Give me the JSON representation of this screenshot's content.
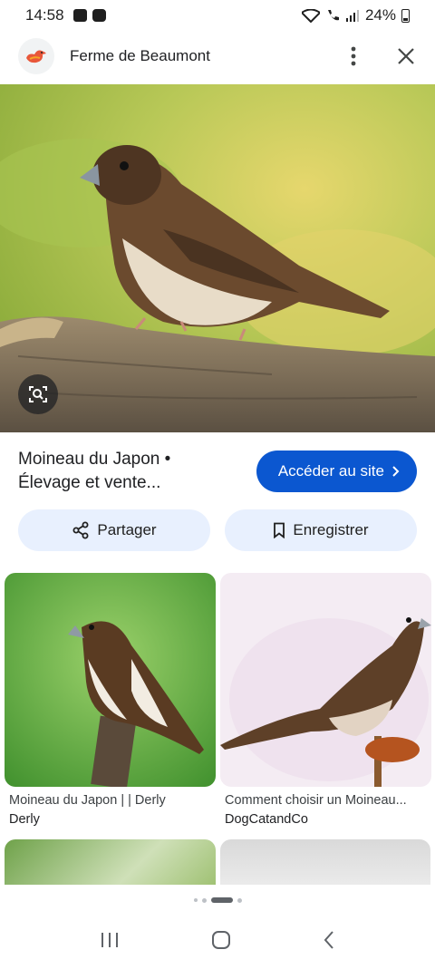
{
  "status_bar": {
    "time": "14:58",
    "battery": "24%"
  },
  "header": {
    "site_name": "Ferme de Beaumont",
    "logo_icon": "duck-logo-icon",
    "menu_icon": "more-vert-icon",
    "close_icon": "close-icon"
  },
  "main": {
    "title": "Moineau du Japon • Élevage et vente...",
    "visit_label": "Accéder au site",
    "share_label": "Partager",
    "save_label": "Enregistrer",
    "lens_icon": "lens-icon"
  },
  "related": [
    {
      "caption": "Moineau du Japon | | Derly",
      "source": "Derly"
    },
    {
      "caption": "Comment choisir un Moineau...",
      "source": "DogCatandCo"
    }
  ],
  "colors": {
    "accent": "#0b57d0",
    "action_bg": "#e8f0fe"
  }
}
